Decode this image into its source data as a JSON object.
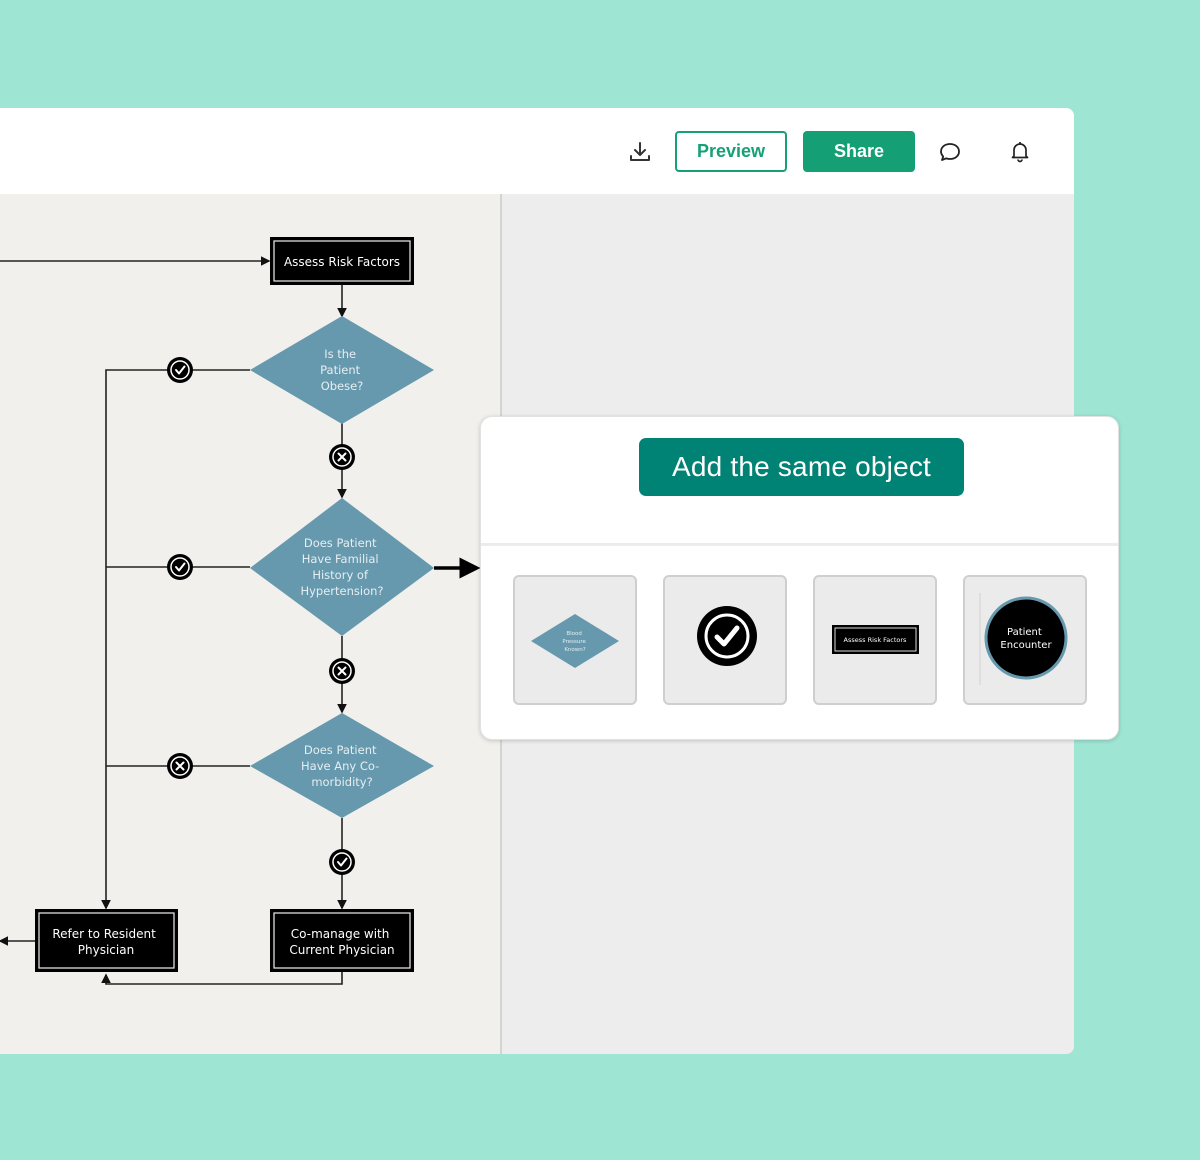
{
  "toolbar": {
    "download_icon": "download-icon",
    "preview_label": "Preview",
    "share_label": "Share",
    "comment_icon": "comment-icon",
    "bell_icon": "bell-icon"
  },
  "colors": {
    "background": "#9fe5d3",
    "accent_green": "#14a074",
    "panel_button": "#008374",
    "diamond_fill": "#6699ad",
    "box_fill": "#000000",
    "canvas": "#f1f0ed"
  },
  "flowchart": {
    "boxes": {
      "assess": "Assess Risk Factors",
      "refer_line1": "Refer to Resident",
      "refer_line2": "Physician",
      "comanage_line1": "Co-manage with",
      "comanage_line2": "Current Physician"
    },
    "decisions": {
      "obese": [
        "Is the",
        "Patient",
        "Obese?"
      ],
      "familial": [
        "Does Patient",
        "Have Familial",
        "History of",
        "Hypertension?"
      ],
      "comorbidity": [
        "Does Patient",
        "Have Any Co-",
        "morbidity?"
      ]
    },
    "markers": {
      "yes": "check-icon",
      "no": "x-icon"
    }
  },
  "panel": {
    "title_button": "Add the same object",
    "tiles": [
      {
        "type": "diamond",
        "lines": [
          "Blood",
          "Pressure",
          "Known?"
        ]
      },
      {
        "type": "check-marker"
      },
      {
        "type": "box",
        "label": "Assess Risk Factors"
      },
      {
        "type": "circle",
        "lines": [
          "Patient",
          "Encounter"
        ]
      }
    ]
  }
}
